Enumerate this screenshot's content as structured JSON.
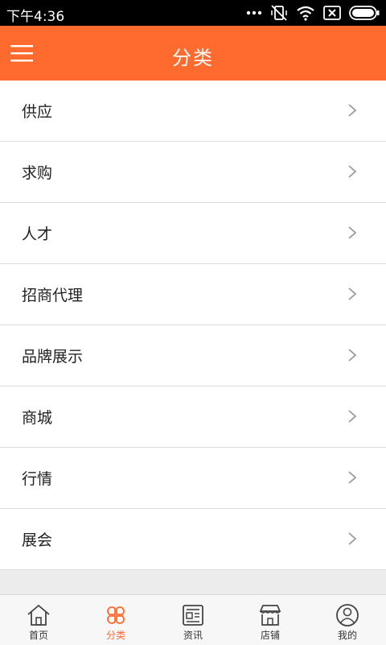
{
  "status_bar": {
    "time": "下午4:36"
  },
  "app_bar": {
    "title": "分类"
  },
  "categories": [
    {
      "label": "供应"
    },
    {
      "label": "求购"
    },
    {
      "label": "人才"
    },
    {
      "label": "招商代理"
    },
    {
      "label": "品牌展示"
    },
    {
      "label": "商城"
    },
    {
      "label": "行情"
    },
    {
      "label": "展会"
    }
  ],
  "tab_bar": {
    "tabs": [
      {
        "label": "首页",
        "icon": "home-icon"
      },
      {
        "label": "分类",
        "icon": "category-icon",
        "active": true
      },
      {
        "label": "资讯",
        "icon": "news-icon"
      },
      {
        "label": "店铺",
        "icon": "store-icon"
      },
      {
        "label": "我的",
        "icon": "profile-icon"
      }
    ]
  },
  "colors": {
    "accent": "#ff6a2f",
    "background": "#ececec"
  }
}
